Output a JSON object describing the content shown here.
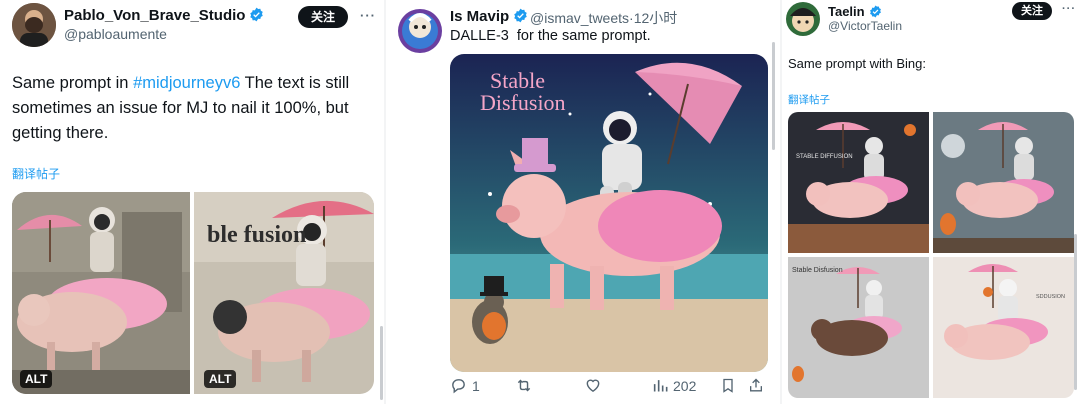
{
  "follow_label": "关注",
  "more_glyph": "···",
  "posts": [
    {
      "name": "Pablo_Von_Brave_Studio",
      "handle": "@pabloaumente",
      "text_before": "Same prompt in ",
      "hashtag": "#midjourneyv6",
      "text_after": " The text is still sometimes an issue for MJ to nail it 100%, but getting there.",
      "translate": "翻译帖子",
      "alt_badge": "ALT",
      "image1_lettering": "ble fusion"
    },
    {
      "name": "Is Mavip",
      "handle": "@ismav_tweets",
      "time": "·12小时",
      "text": "DALLE-3  for the same prompt.",
      "image_lettering_line1": "Stable",
      "image_lettering_line2": "Disfusion",
      "replies": "1",
      "views": "202"
    },
    {
      "name": "Taelin",
      "handle": "@VictorTaelin",
      "text": "Same prompt with Bing:",
      "translate": "翻译帖子",
      "grid_lettering_1": "STABLE DIFFUSION",
      "grid_lettering_3": "Stable Disfusion",
      "grid_lettering_4": "SDDUSION"
    }
  ],
  "colors": {
    "link": "#1d9bf0",
    "text": "#0f1419",
    "secondary": "#536471",
    "verified": "#1d9bf0",
    "follow_bg": "#0f1419"
  },
  "icons": [
    "verified-badge-icon",
    "more-icon",
    "reply-icon",
    "retweet-icon",
    "like-icon",
    "views-icon",
    "bookmark-icon",
    "share-icon"
  ]
}
